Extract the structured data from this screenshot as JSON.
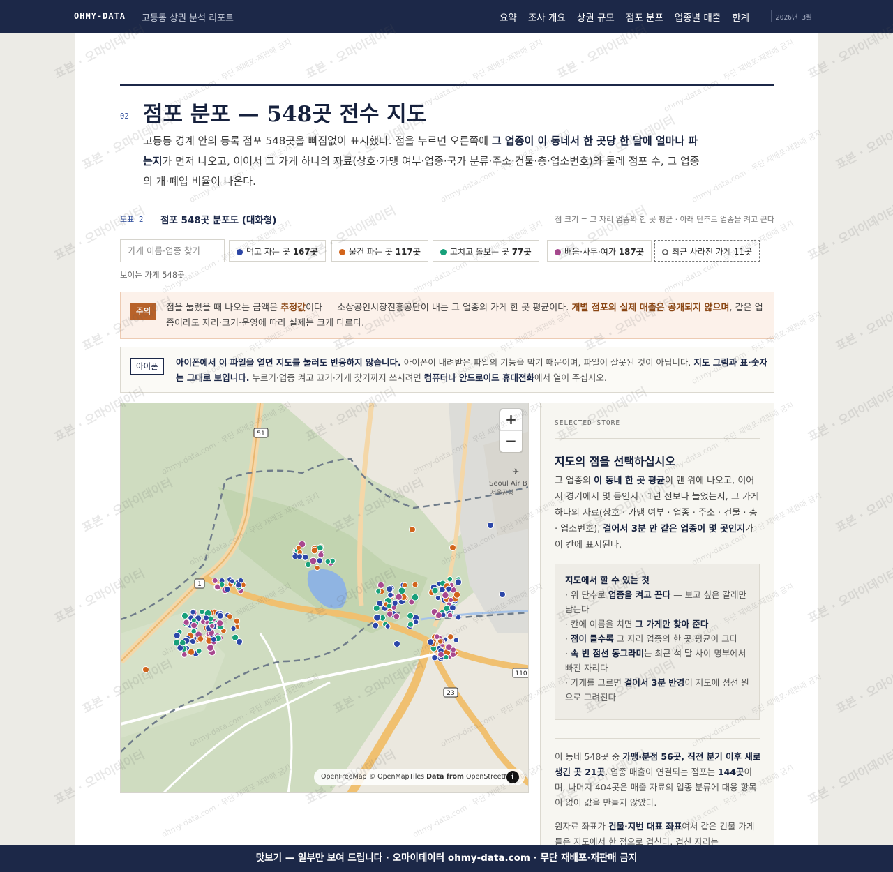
{
  "header": {
    "brand": "OHMY-DATA",
    "subtitle": "고등동 상권 분석 리포트",
    "nav": [
      "요약",
      "조사 개요",
      "상권 규모",
      "점포 분포",
      "업종별 매출",
      "한계"
    ],
    "date": "2026년 3월"
  },
  "section": {
    "number": "02",
    "title": "점포 분포 — 548곳 전수 지도",
    "lead_1": "고등동 경계 안의 등록 점포 548곳을 빠짐없이 표시했다. 점을 누르면 오른쪽에 ",
    "lead_bold": "그 업종이 이 동네서 한 곳당 한 달에 얼마나 파는지",
    "lead_2": "가 먼저 나오고, 이어서 그 가게 하나의 자료(상호·가맹 여부·업종·국가 분류·주소·건물·층·업소번호)와 둘레 점포 수, 그 업종의 개·폐업 비율이 나온다."
  },
  "figure": {
    "label": "도표 2",
    "title": "점포 548곳 분포도 (대화형)",
    "note": "점 크기 = 그 자리 업종의 한 곳 평균 · 아래 단추로 업종을 켜고 끈다"
  },
  "filters": {
    "search_placeholder": "가게 이름·업종 찾기",
    "chips": [
      {
        "label": "먹고 자는 곳",
        "count": "167곳",
        "color": "#2b46a8"
      },
      {
        "label": "물건 파는 곳",
        "count": "117곳",
        "color": "#d2641b"
      },
      {
        "label": "고치고 돌보는 곳",
        "count": "77곳",
        "color": "#17a07a"
      },
      {
        "label": "배움·사무·여가",
        "count": "187곳",
        "color": "#a8488f"
      },
      {
        "label": "최근 사라진 가게",
        "count": "11곳",
        "color": "#666666"
      }
    ],
    "visible_count": "보이는 가게 548곳"
  },
  "warning": {
    "tag": "주의",
    "t1": "점을 눌렀을 때 나오는 금액은 ",
    "b1": "추정값",
    "t2": "이다 — 소상공인시장진흥공단이 내는 그 업종의 가게 한 곳 평균이다. ",
    "b2": "개별 점포의 실제 매출은 공개되지 않으며",
    "t3": ", 같은 업종이라도 자리·크기·운영에 따라 실제는 크게 다르다."
  },
  "ios_notice": {
    "tag": "아이폰",
    "b1": "아이폰에서 이 파일을 열면 지도를 눌러도 반응하지 않습니다.",
    "t1": " 아이폰이 내려받은 파일의 기능을 막기 때문이며, 파일이 잘못된 것이 아닙니다. ",
    "b2": "지도 그림과 표·숫자는 그대로 보입니다.",
    "t2": " 누르기·업종 켜고 끄기·가게 찾기까지 쓰시려면 ",
    "b3": "컴퓨터나 안드로이드 휴대전화",
    "t3": "에서 열어 주십시오."
  },
  "map": {
    "zoom_in": "+",
    "zoom_out": "−",
    "attribution_1": "OpenFreeMap © OpenMapTiles ",
    "attribution_bold": "Data from",
    "attribution_2": " OpenStreetMap",
    "info": "i",
    "labels": {
      "road_51": "51",
      "road_1": "1",
      "road_110": "110",
      "road_23": "23",
      "airbase_en": "Seoul Air B",
      "airbase_ko": "서울공항"
    }
  },
  "side_panel": {
    "kicker": "SELECTED STORE",
    "title": "지도의 점을 선택하십시오",
    "d1": "그 업종의 ",
    "d1b": "이 동네 한 곳 평균",
    "d2": "이 맨 위에 나오고, 이어서 경기에서 몇 등인지 · 1년 전보다 늘었는지, 그 가게 하나의 자료(상호 · 가맹 여부 · 업종 · 주소 · 건물 · 층 · 업소번호), ",
    "d2b": "걸어서 3분 안 같은 업종이 몇 곳인지",
    "d3": "가 이 칸에 표시된다.",
    "howto_title": "지도에서 할 수 있는 것",
    "howto": [
      {
        "pre": "· 위 단추로 ",
        "bold": "업종을 켜고 끈다",
        "post": " — 보고 싶은 갈래만 남는다"
      },
      {
        "pre": "· 칸에 이름을 치면 ",
        "bold": "그 가게만 찾아 준다",
        "post": ""
      },
      {
        "pre": "· ",
        "bold": "점이 클수록",
        "post": " 그 자리 업종의 한 곳 평균이 크다"
      },
      {
        "pre": "· ",
        "bold": "속 빈 점선 동그라미",
        "post": "는 최근 석 달 사이 명부에서 빠진 자리다"
      },
      {
        "pre": "· 가게를 고르면 ",
        "bold": "걸어서 3분 반경",
        "post": "이 지도에 점선 원으로 그려진다"
      }
    ],
    "s1": "이 동네 548곳 중 ",
    "s1b": "가맹·분점 56곳, 직전 분기 이후 새로 생긴 곳 21곳",
    "s2": ". 업종 매출이 연결되는 점포는 ",
    "s2b": "144곳",
    "s3": "이며, 나머지 404곳은 매출 자료의 업종 분류에 대응 항목이 없어 값을 만들지 않았다.",
    "c1": "원자료 좌표가 ",
    "c1b": "건물·지번 대표 좌표",
    "c2": "여서 같은 건물 가게들은 지도에서 한 점으로 겹친다. 겹친 자리는"
  },
  "banner": "맛보기 — 일부만 보여 드립니다 · 오마이데이터 ohmy-data.com · 무단 재배포·재판매 금지",
  "watermark": {
    "a": "표본 · 오마이데이터",
    "b": "ohmy-data.com · 무단 재배포·재판매 금지"
  },
  "colors": {
    "navy": "#1c2848",
    "food": "#2b46a8",
    "retail": "#d2641b",
    "service": "#17a07a",
    "leisure": "#a8488f"
  }
}
